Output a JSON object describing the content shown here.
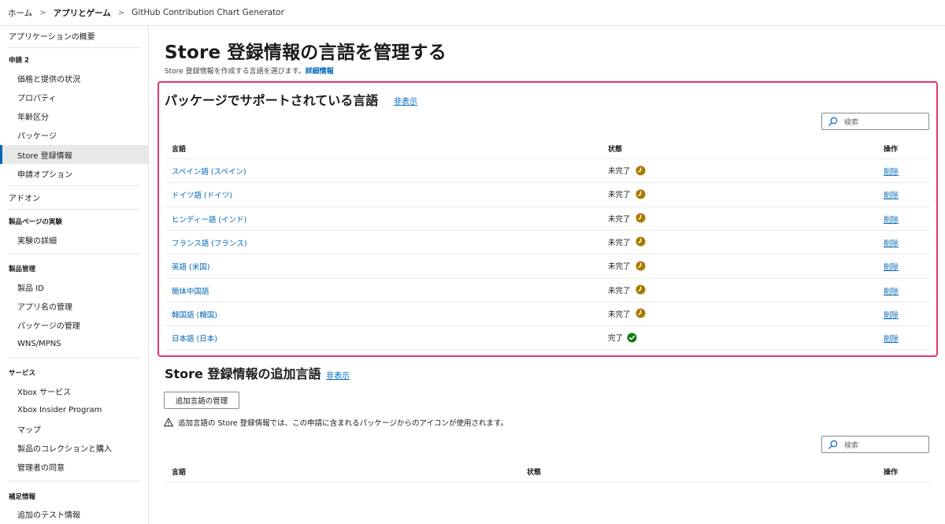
{
  "breadcrumb": {
    "home": "ホーム",
    "apps": "アプリとゲーム",
    "current": "GitHub Contribution Chart Generator",
    "separator": ">"
  },
  "sidebar": {
    "overview": "アプリケーションの概要",
    "submission_header": "申請 2",
    "submission_items": [
      "価格と提供の状況",
      "プロパティ",
      "年齢区分",
      "パッケージ",
      "Store 登録情報",
      "申請オプション"
    ],
    "addons": "アドオン",
    "experiments_header": "製品ページの実験",
    "experiments_items": [
      "実験の詳細"
    ],
    "product_mgmt_header": "製品管理",
    "product_mgmt_items": [
      "製品 ID",
      "アプリ名の管理",
      "パッケージの管理",
      "WNS/MPNS"
    ],
    "services_header": "サービス",
    "services_items": [
      "Xbox サービス",
      "Xbox Insider Program",
      "マップ",
      "製品のコレクションと購入",
      "管理者の同意"
    ],
    "extra_header": "補足情報",
    "extra_items": [
      "追加のテスト情報"
    ]
  },
  "page": {
    "title": "Store 登録情報の言語を管理する",
    "subtitle": "Store 登録情報を作成する言語を選びます。",
    "more_info": "詳細情報"
  },
  "supported": {
    "title": "パッケージでサポートされている言語",
    "hide": "非表示",
    "search_placeholder": "検索",
    "columns": {
      "lang": "言語",
      "status": "状態",
      "action": "操作"
    },
    "rows": [
      {
        "lang": "スペイン語 (スペイン)",
        "status": "未完了",
        "action": "削除"
      },
      {
        "lang": "ドイツ語 (ドイツ)",
        "status": "未完了",
        "action": "削除"
      },
      {
        "lang": "ヒンディー語 (インド)",
        "status": "未完了",
        "action": "削除"
      },
      {
        "lang": "フランス語 (フランス)",
        "status": "未完了",
        "action": "削除"
      },
      {
        "lang": "英語 (米国)",
        "status": "未完了",
        "action": "削除"
      },
      {
        "lang": "簡体中国語",
        "status": "未完了",
        "action": "削除"
      },
      {
        "lang": "韓国語 (韓国)",
        "status": "未完了",
        "action": "削除"
      },
      {
        "lang": "日本語 (日本)",
        "status": "完了",
        "action": "削除"
      }
    ],
    "colors": {
      "pending": "#a97b00",
      "done": "#107c10"
    }
  },
  "additional": {
    "title": "Store 登録情報の追加言語",
    "hide": "非表示",
    "manage_button": "追加言語の管理",
    "warning": "追加言語の Store 登録情報では、この申請に含まれるパッケージからのアイコンが使用されます。",
    "search_placeholder": "検索",
    "columns": {
      "lang": "言語",
      "status": "状態",
      "action": "操作"
    }
  },
  "colors": {
    "accent": "#0067b8",
    "highlight_border": "#e8336a"
  }
}
